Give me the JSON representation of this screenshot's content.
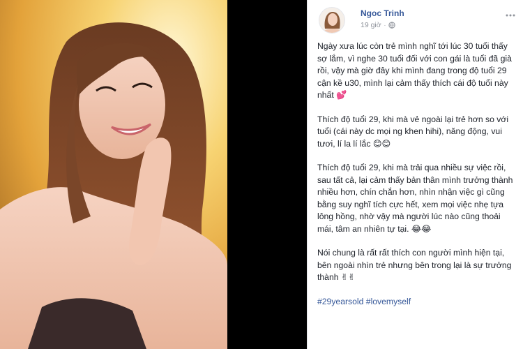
{
  "post": {
    "author": "Ngoc Trinh",
    "timestamp": "19 giờ",
    "privacy_icon": "globe-icon",
    "more_icon": "more-options-icon",
    "paragraphs": [
      {
        "text": "Ngày xưa lúc còn trẻ mình nghĩ tới lúc 30 tuổi thấy sợ lắm, vì nghe 30 tuổi đối với con gái là tuổi đã già rồi, vậy mà giờ đây khi mình đang trong độ tuổi 29 cận kề u30, mình lại cảm thấy thích cái độ tuổi này nhất",
        "emoji": "💕"
      },
      {
        "text": "Thích độ tuổi 29, khi mà vẻ ngoài lại trẻ hơn so với tuổi (cái này dc mọi ng khen hihi), năng động, vui tươi, lí la lí lắc",
        "emoji": "😊😊"
      },
      {
        "text": "Thích độ tuổi 29, khi mà trải qua nhiều sự việc rồi, sau tất cả, lại cảm thấy bản thân mình trưởng thành nhiều hơn, chín chắn hơn, nhìn nhận việc gì cũng bằng suy nghĩ tích cực hết, xem mọi việc nhẹ tựa lông hồng, nhờ vậy mà người lúc nào cũng thoải mái, tâm an nhiên tự tại.",
        "emoji": "😂😂"
      },
      {
        "text": "Nói chung là rất rất thích con người mình hiện tại, bên ngoài nhìn trẻ nhưng bên trong lại là sự trưởng thành",
        "emoji": "✌✌"
      }
    ],
    "hashtags": [
      "#29yearsold",
      "#lovemyself"
    ]
  },
  "colors": {
    "author_link": "#365899",
    "body_text": "#1d2129",
    "meta_text": "#90949c",
    "divider": "#000000"
  }
}
